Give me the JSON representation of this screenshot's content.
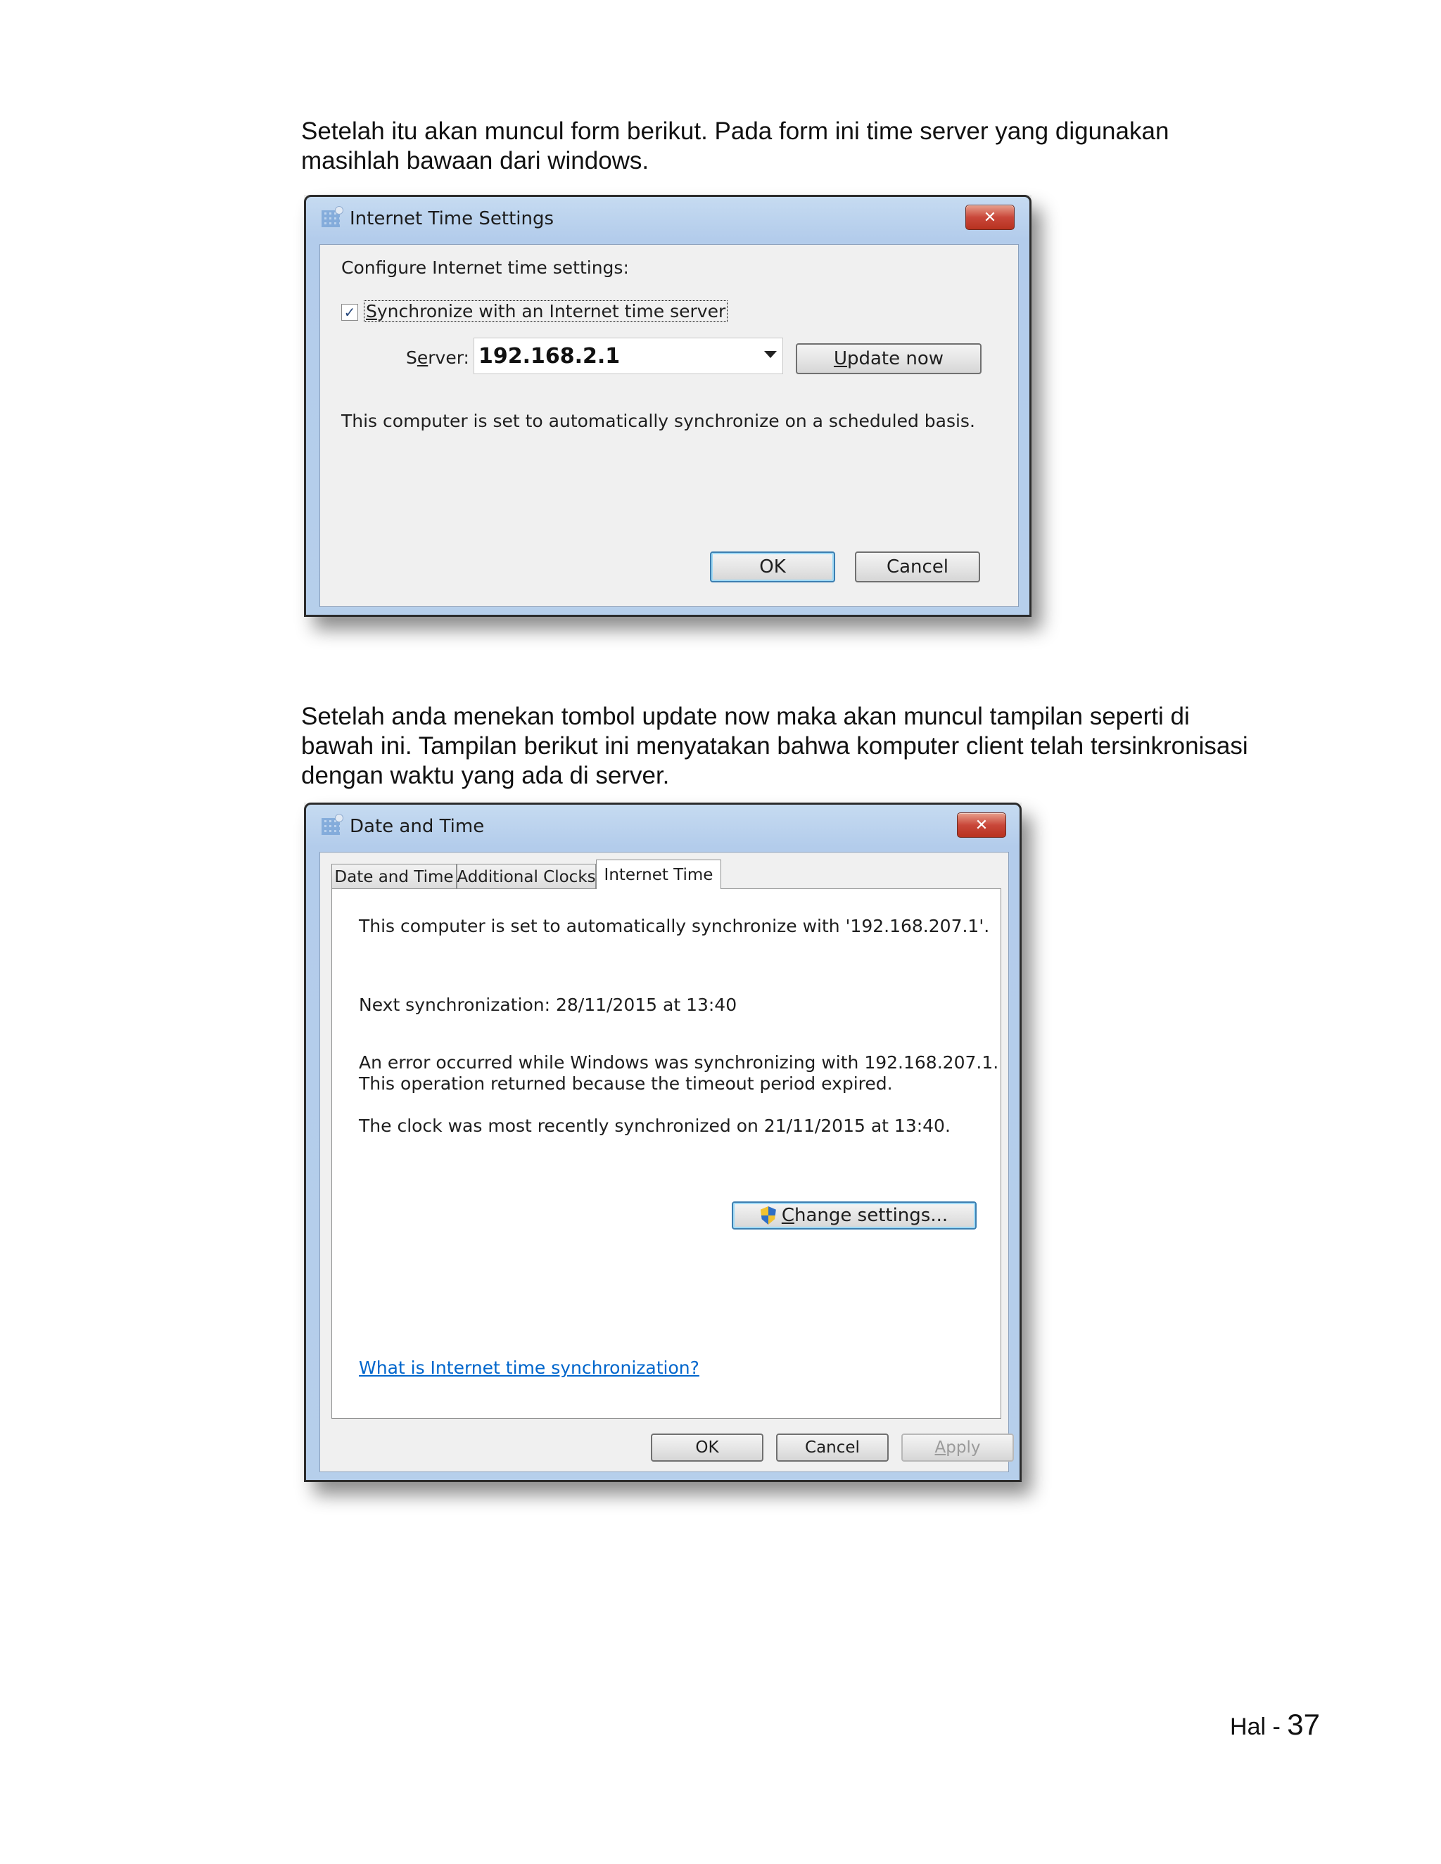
{
  "paragraph1": {
    "lines": [
      "Setelah itu akan muncul form berikut. Pada form ini time server yang digunakan",
      "masihlah bawaan dari windows."
    ]
  },
  "dialog1": {
    "title": "Internet Time Settings",
    "close_glyph": "✕",
    "heading": "Configure Internet time settings:",
    "sync_checkbox": {
      "checked": true,
      "label_first": "S",
      "label_rest": "ynchronize with an Internet time server"
    },
    "server_label_pre": "S",
    "server_label_u": "e",
    "server_label_post": "rver:",
    "server_value": "192.168.2.1",
    "update_button_u": "U",
    "update_button_rest": "pdate now",
    "status": "This computer is set to automatically synchronize on a scheduled basis.",
    "ok_label": "OK",
    "cancel_label": "Cancel"
  },
  "paragraph2": {
    "lines": [
      "Setelah anda menekan tombol update now maka akan muncul tampilan seperti di",
      "bawah ini. Tampilan berikut ini menyatakan bahwa komputer client telah tersinkronisasi",
      "dengan waktu yang ada di server."
    ]
  },
  "dialog2": {
    "title": "Date and Time",
    "close_glyph": "✕",
    "tabs": [
      "Date and Time",
      "Additional Clocks",
      "Internet Time"
    ],
    "active_tab": "Internet Time",
    "sync_info": "This computer is set to automatically synchronize with '192.168.207.1'.",
    "next_sync": "Next synchronization: 28/11/2015 at 13:40",
    "error_line1": "An error occurred while Windows was synchronizing with 192.168.207.1.",
    "error_line2": "This operation returned because the timeout period expired.",
    "last_sync": "The clock was most recently synchronized on 21/11/2015 at 13:40.",
    "change_settings_u": "C",
    "change_settings_rest": "hange settings...",
    "help_link": "What is Internet time synchronization?",
    "ok_label": "OK",
    "cancel_label": "Cancel",
    "apply_u": "A",
    "apply_rest": "pply"
  },
  "footer": {
    "prefix": "Hal - ",
    "page_number": "37"
  }
}
